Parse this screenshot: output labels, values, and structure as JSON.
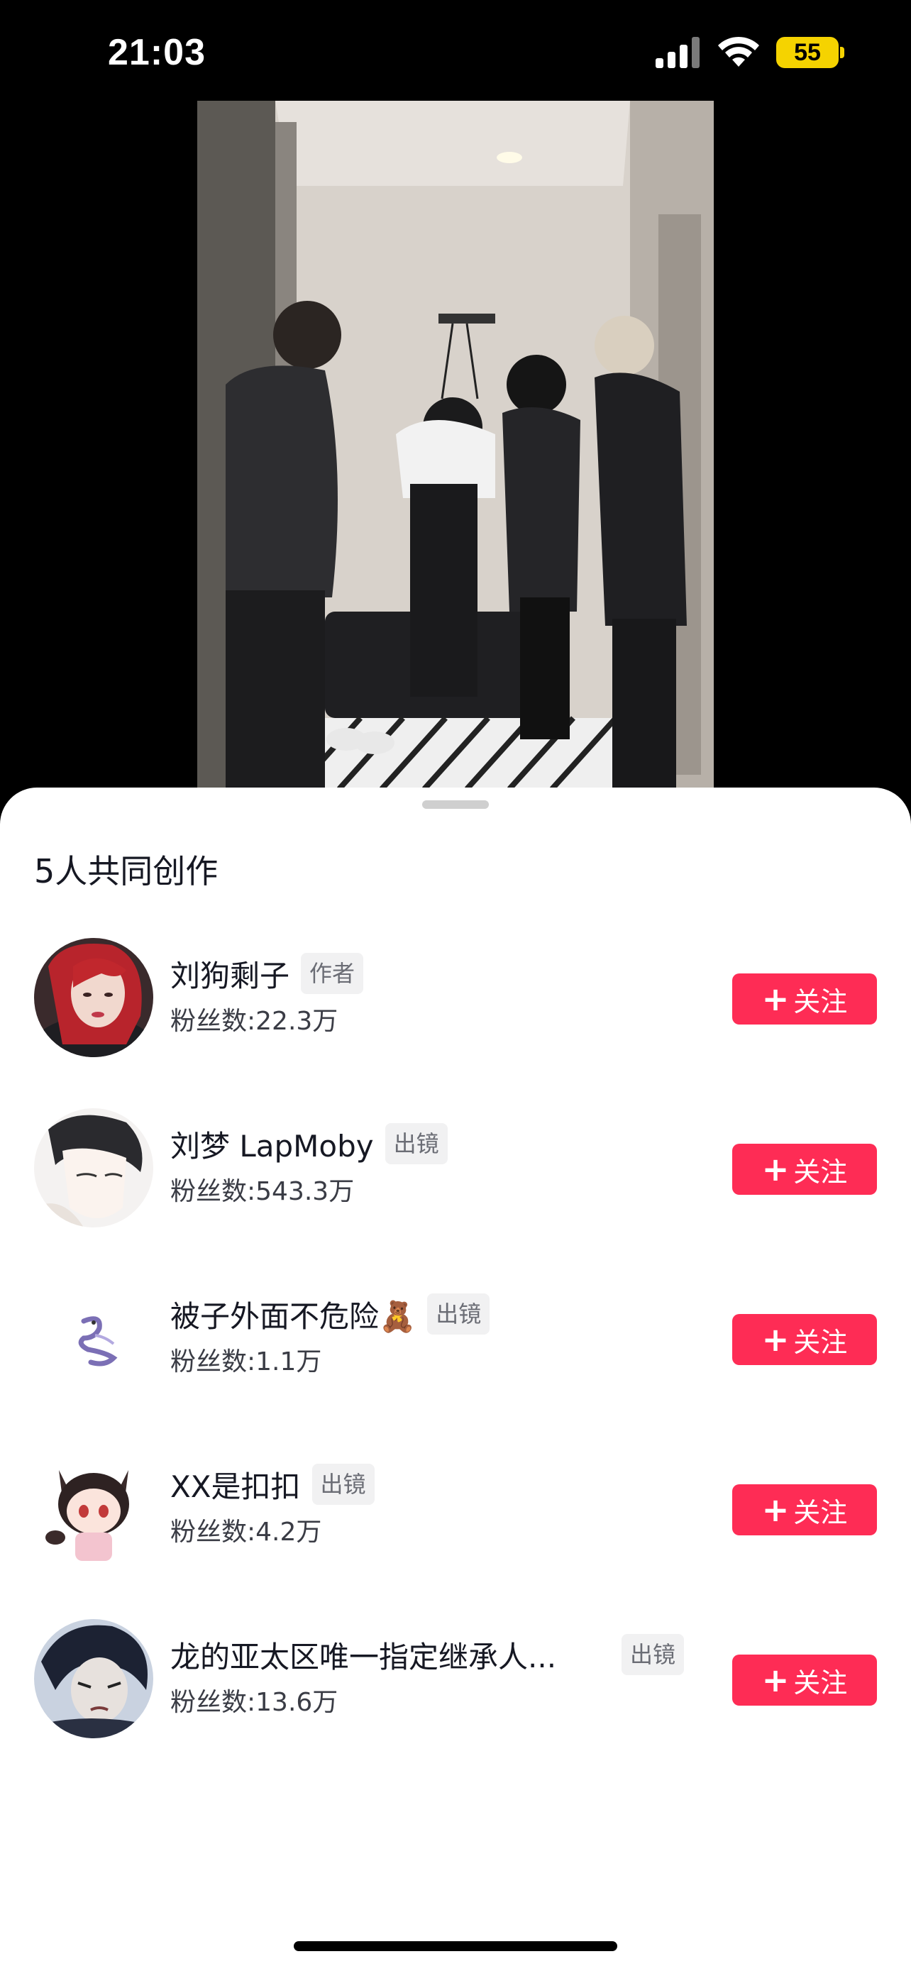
{
  "status_bar": {
    "time": "21:03",
    "battery_level": "55",
    "battery_color": "#f5d300",
    "icons": [
      "signal-icon",
      "wifi-icon",
      "battery-icon"
    ]
  },
  "video": {
    "description_icon": "video-preview"
  },
  "sheet": {
    "title": "5人共同创作",
    "creators": [
      {
        "name": "刘狗剩子",
        "role": "作者",
        "fans": "粉丝数:22.3万",
        "follow_label": "关注"
      },
      {
        "name": "刘梦 LapMoby",
        "role": "出镜",
        "fans": "粉丝数:543.3万",
        "follow_label": "关注"
      },
      {
        "name": "被子外面不危险🧸",
        "role": "出镜",
        "fans": "粉丝数:1.1万",
        "follow_label": "关注"
      },
      {
        "name": "XX是扣扣",
        "role": "出镜",
        "fans": "粉丝数:4.2万",
        "follow_label": "关注"
      },
      {
        "name": "龙的亚太区唯一指定继承人...",
        "role": "出镜",
        "fans": "粉丝数:13.6万",
        "follow_label": "关注"
      }
    ]
  },
  "colors": {
    "accent": "#fe2c55",
    "badge_bg": "#f1f1f2",
    "text_primary": "#161823"
  }
}
